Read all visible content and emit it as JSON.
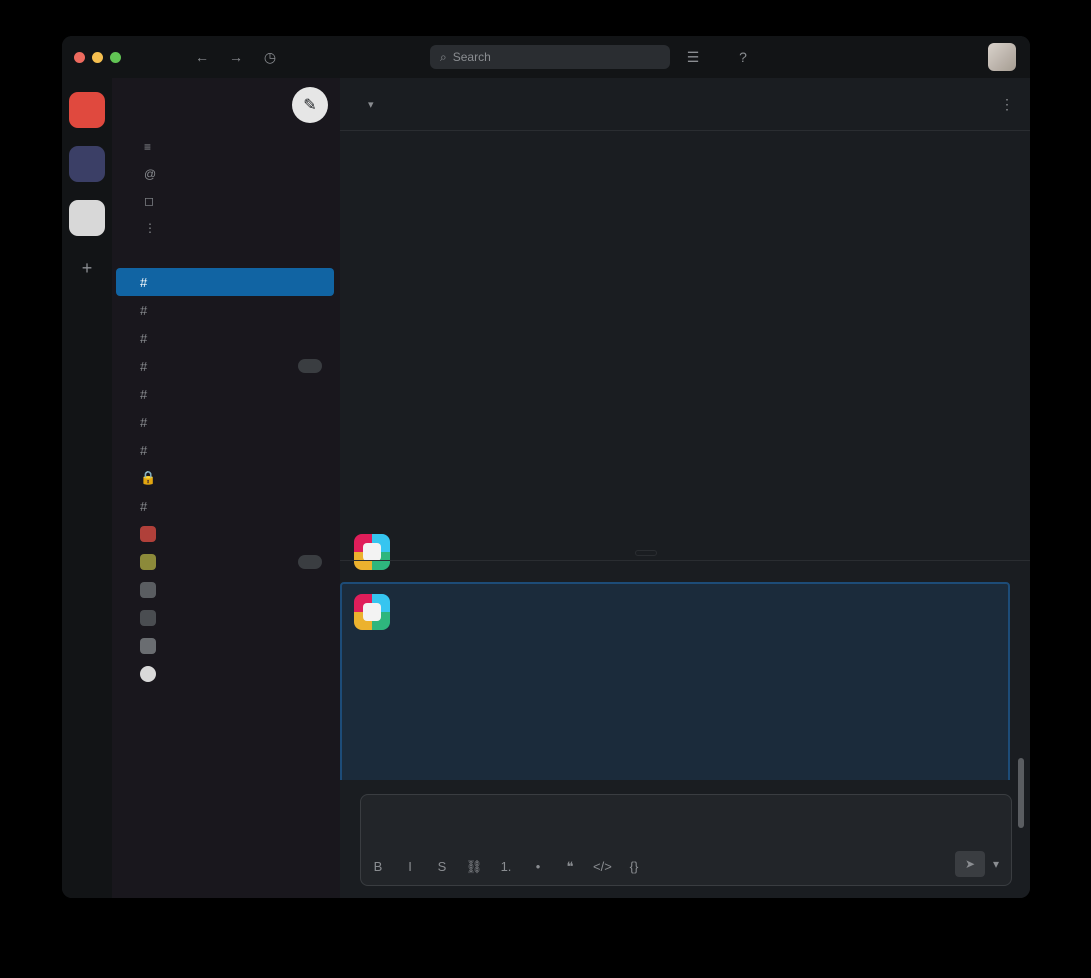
{
  "window": {
    "traffic_colors": [
      "#ed6a5e",
      "#f5bf4f",
      "#61c454"
    ]
  },
  "topbar": {
    "nav_icons": [
      {
        "name": "back-arrow-icon",
        "glyph": "←"
      },
      {
        "name": "forward-arrow-icon",
        "glyph": "→"
      },
      {
        "name": "history-icon",
        "glyph": "◷"
      }
    ],
    "search_placeholder": "Search",
    "help_icon": "?"
  },
  "rail": {
    "workspaces": [
      {
        "letter": "",
        "color": "#e0493e"
      },
      {
        "letter": "",
        "color": "#3b3f66"
      },
      {
        "letter": "",
        "color": "#d8d8d8"
      }
    ],
    "add_glyph": "+"
  },
  "sidebar": {
    "workspace_name": "",
    "compose_glyph": "✎",
    "nav_items": [
      {
        "icon": "≡",
        "label": ""
      },
      {
        "icon": "@",
        "label": ""
      },
      {
        "icon": "◻",
        "label": ""
      },
      {
        "icon": "⋮",
        "label": ""
      }
    ],
    "channels_header": "",
    "channels": [
      {
        "label": "",
        "active": true,
        "badge": ""
      },
      {
        "label": "",
        "active": false,
        "badge": ""
      },
      {
        "label": "",
        "active": false,
        "badge": ""
      },
      {
        "label": "",
        "active": false,
        "badge": ""
      },
      {
        "label": "",
        "active": false,
        "badge": ""
      },
      {
        "label": "",
        "active": false,
        "badge": ""
      },
      {
        "label": "",
        "active": false,
        "badge": ""
      },
      {
        "label": "",
        "active": false,
        "badge": ""
      },
      {
        "label": "",
        "active": false,
        "badge": ""
      },
      {
        "label": "",
        "active": false,
        "badge": ""
      },
      {
        "label": "",
        "active": false,
        "badge": ""
      },
      {
        "label": "",
        "active": false,
        "badge": ""
      },
      {
        "label": "",
        "active": false,
        "badge": ""
      },
      {
        "label": "",
        "active": false,
        "badge": ""
      },
      {
        "label": "",
        "active": false,
        "badge": ""
      }
    ],
    "footer_items": [
      "",
      ""
    ]
  },
  "main": {
    "channel_title": "",
    "messages_top": [
      {
        "text": ""
      },
      {
        "text": ""
      },
      {
        "text": ""
      },
      {
        "text": ""
      },
      {
        "text": ""
      },
      {
        "text": ""
      },
      {
        "text": ""
      },
      {
        "text": ""
      }
    ],
    "bot_message_1": {
      "author": "",
      "time": "",
      "text": ""
    },
    "divider_label": "",
    "bot_message_2": {
      "author": "",
      "time": "",
      "lines": [
        "",
        "",
        "",
        "",
        "",
        "",
        ""
      ]
    },
    "composer": {
      "placeholder": "",
      "format_icons": [
        {
          "name": "bold-icon",
          "glyph": "B"
        },
        {
          "name": "italic-icon",
          "glyph": "I"
        },
        {
          "name": "strikethrough-icon",
          "glyph": "S"
        },
        {
          "name": "link-icon",
          "glyph": "🔗"
        },
        {
          "name": "numbered-list-icon",
          "glyph": "1."
        },
        {
          "name": "bullet-list-icon",
          "glyph": "•"
        },
        {
          "name": "quote-icon",
          "glyph": "❝"
        },
        {
          "name": "code-icon",
          "glyph": "</>"
        },
        {
          "name": "code-block-icon",
          "glyph": "{ }"
        }
      ],
      "send_glyph": "➤",
      "send_options_glyph": "▾"
    }
  }
}
